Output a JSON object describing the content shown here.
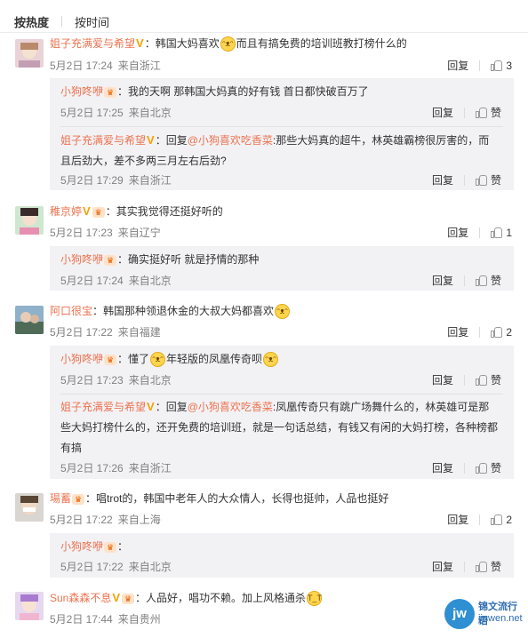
{
  "tabs": {
    "hot": "按热度",
    "time": "按时间"
  },
  "comments": [
    {
      "user": "姐子充满爱与希望",
      "text_a": "：韩国大妈喜欢",
      "text_b": "而且有搞免费的培训班教打榜什么的",
      "date": "5月2日 17:24",
      "source": "来自浙江",
      "reply": "回复",
      "likes": "3",
      "replies": [
        {
          "user": "小狗咚咿",
          "text": "：我的天啊 那韩国大妈真的好有钱 首日都快破百万了",
          "date": "5月2日 17:25",
          "source": "来自北京",
          "reply": "回复",
          "like": "赞"
        },
        {
          "user": "姐子充满爱与希望",
          "text_pre": "：回复",
          "mention": "@小狗喜欢吃香菜",
          "text_l1": ":那些大妈真的超牛，林英雄霸榜很厉害的，而",
          "text_l2": "且后劲大，差不多两三月左右后劲?",
          "date": "5月2日 17:29",
          "source": "来自浙江",
          "reply": "回复",
          "like": "赞"
        }
      ]
    },
    {
      "user": "稚京婷",
      "text": "：其实我觉得还挺好听的",
      "date": "5月2日 17:23",
      "source": "来自辽宁",
      "reply": "回复",
      "likes": "1",
      "replies": [
        {
          "user": "小狗咚咿",
          "text": "：确实挺好听 就是抒情的那种",
          "date": "5月2日 17:24",
          "source": "来自北京",
          "reply": "回复",
          "like": "赞"
        }
      ]
    },
    {
      "user": "阿口很宝",
      "text": "：韩国那种领退休金的大叔大妈都喜欢",
      "date": "5月2日 17:22",
      "source": "来自福建",
      "reply": "回复",
      "likes": "2",
      "replies": [
        {
          "user": "小狗咚咿",
          "text_a": "：懂了",
          "text_b": "年轻版的凤凰传奇呗",
          "date": "5月2日 17:23",
          "source": "来自北京",
          "reply": "回复",
          "like": "赞"
        },
        {
          "user": "姐子充满爱与希望",
          "text_pre": "：回复",
          "mention": "@小狗喜欢吃香菜",
          "text_l1": ":凤凰传奇只有跳广场舞什么的，林英雄可是那",
          "text_l2": "些大妈打榜什么的，还开免费的培训班，就是一句话总结，有钱又有闲的大妈打榜，各种榜都",
          "text_l3": "有搞",
          "date": "5月2日 17:26",
          "source": "来自浙江",
          "reply": "回复",
          "like": "赞"
        }
      ]
    },
    {
      "user": "瑒蓄",
      "text": "：唱trot的，韩国中老年人的大众情人，长得也挺帅，人品也挺好",
      "date": "5月2日 17:22",
      "source": "来自上海",
      "reply": "回复",
      "likes": "2",
      "replies": [
        {
          "user": "小狗咚咿",
          "text": "：",
          "date": "5月2日 17:22",
          "source": "来自北京",
          "reply": "回复",
          "like": "赞"
        }
      ]
    },
    {
      "user": "Sun森森不息",
      "text": "：人品好，唱功不赖。加上风格通杀",
      "date": "5月2日 17:44",
      "source": "来自贵州",
      "reply": "回复"
    }
  ],
  "watermark": {
    "logo": "jw",
    "line1": "锦文流行语",
    "line2": "jinwen.net"
  },
  "colors": {
    "username": "#eb7350",
    "badge": "#f5a100",
    "reply_bg": "#f2f2f5"
  }
}
